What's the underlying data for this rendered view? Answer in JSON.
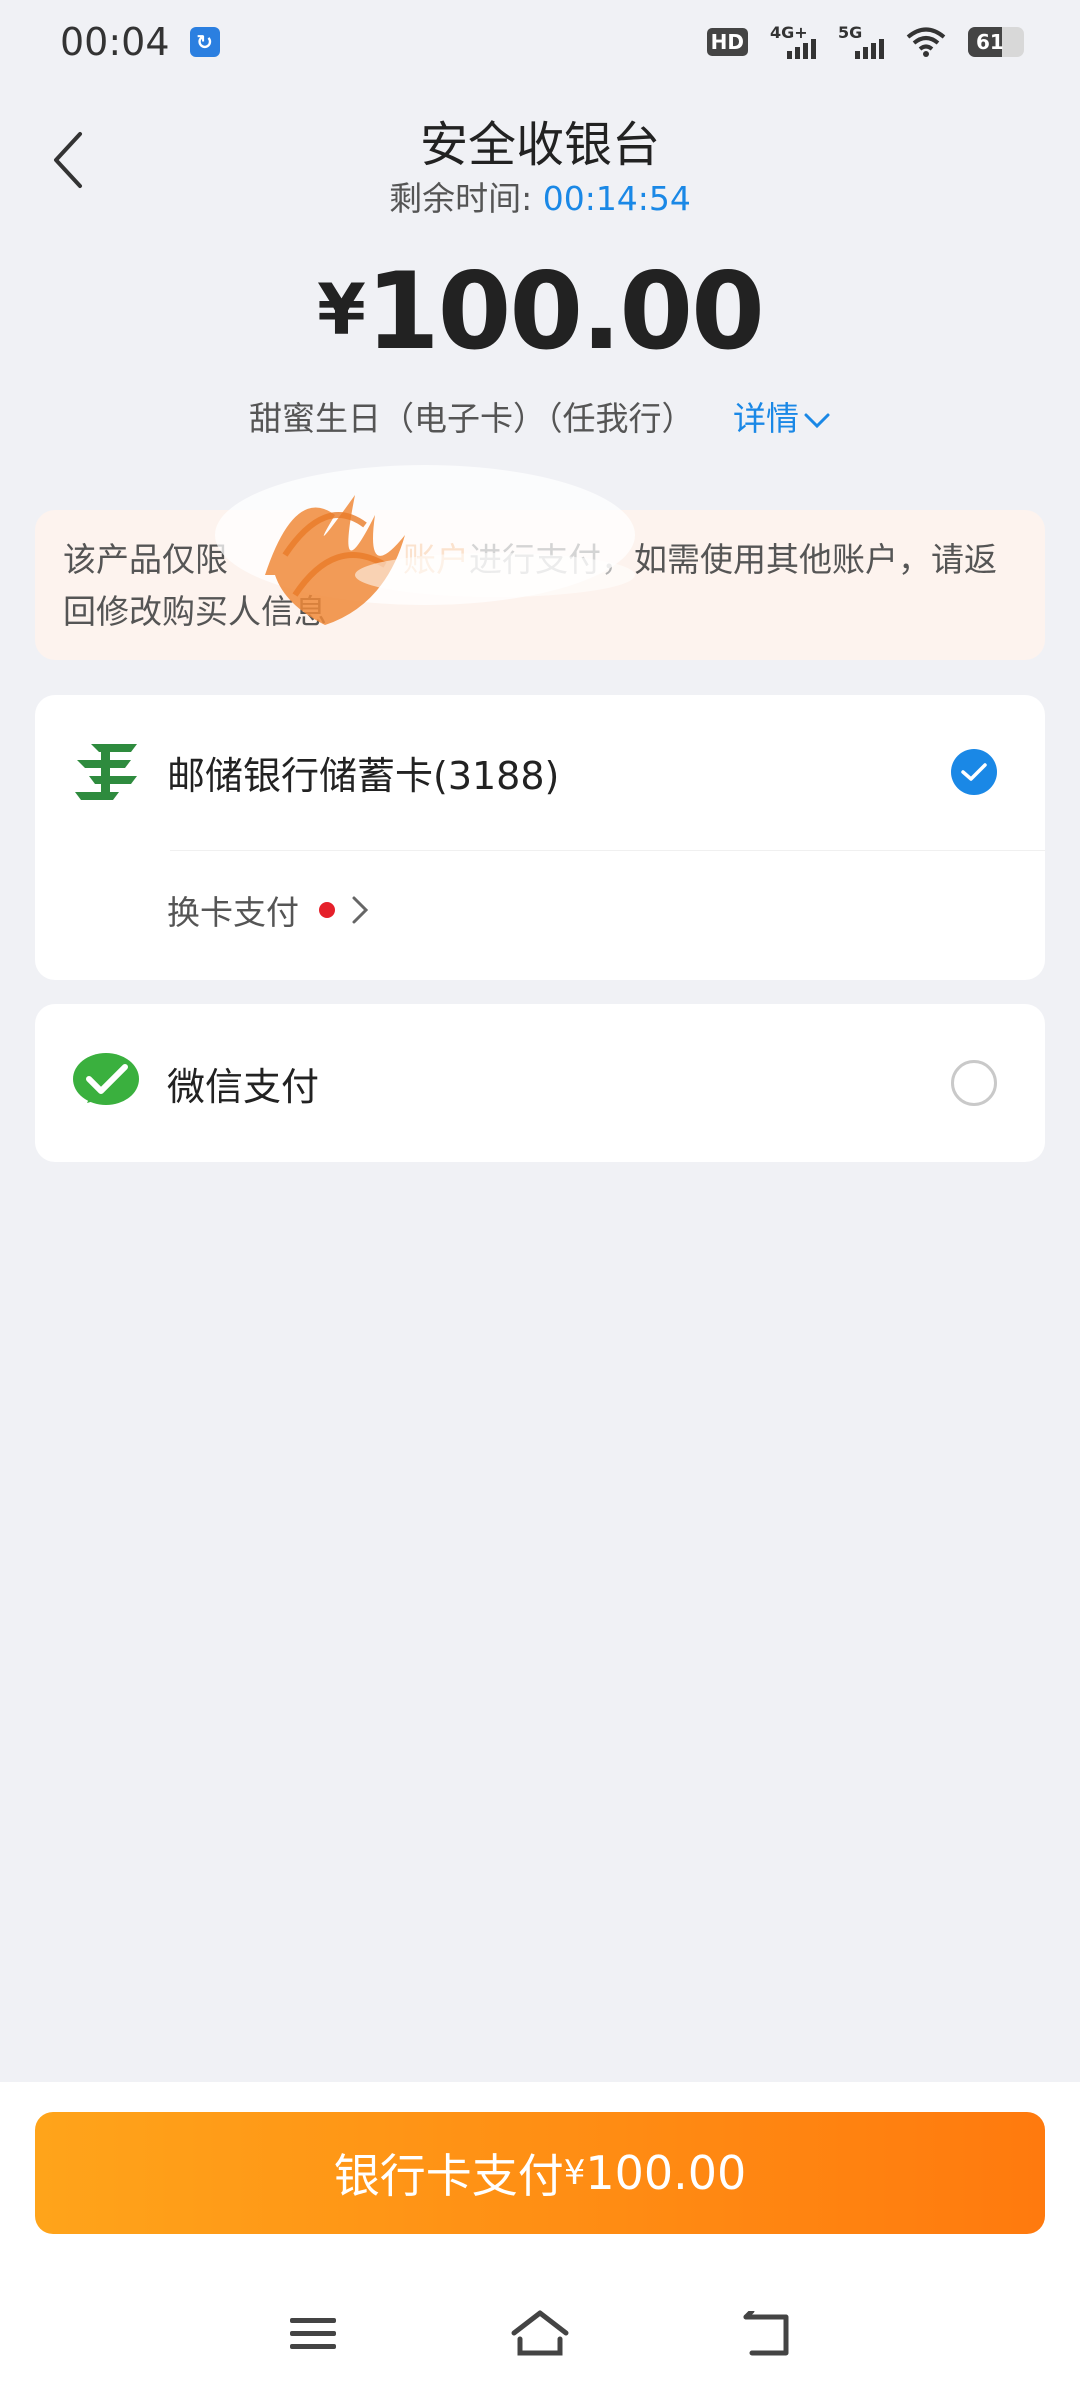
{
  "status_bar": {
    "time": "00:04",
    "hd_label": "HD",
    "network_1": "4G+",
    "network_2": "5G",
    "battery": "61"
  },
  "header": {
    "title": "安全收银台",
    "timer_label": "剩余时间:",
    "timer_value": "00:14:54"
  },
  "order": {
    "currency": "¥",
    "amount": "100.00",
    "product": "甜蜜生日（电子卡）（任我行）",
    "detail_label": "详情"
  },
  "notice": {
    "text_a": "该产品仅限",
    "text_b": "账户",
    "text_c": "进行支付，如需使用其他账户，请返回修改购买人信息"
  },
  "payment_methods": [
    {
      "label": "邮储银行储蓄卡(3188)",
      "selected": true,
      "switch_label": "换卡支付"
    },
    {
      "label": "微信支付",
      "selected": false
    }
  ],
  "pay_button": {
    "label": "银行卡支付",
    "currency": "¥",
    "amount": "100.00"
  },
  "colors": {
    "accent_blue": "#1a88e6",
    "button_orange_start": "#ffa41a",
    "button_orange_end": "#ff7a0e",
    "notice_bg": "#fdf3ee",
    "bank_green": "#2e8b3e",
    "wechat_green": "#3ab03e"
  }
}
